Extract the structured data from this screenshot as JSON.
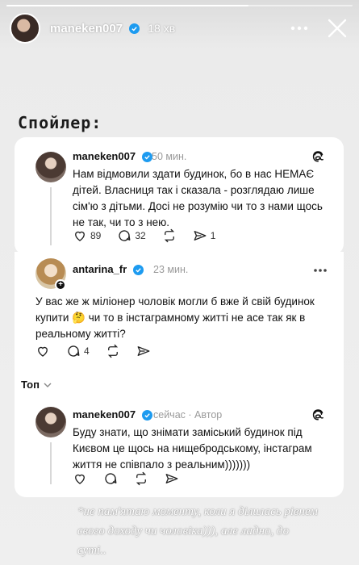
{
  "story": {
    "username": "maneken007",
    "time": "18 хв",
    "progress": 0.7,
    "accent": "#1d9bf0"
  },
  "heading": "Спойлер:",
  "posts": [
    {
      "username": "maneken007",
      "time": "50 мин.",
      "text": "Нам відмовили здати будинок, бо в нас НЕМАЄ дітей. Власниця так і сказала - розглядаю лише сім'ю з дітьми. Досі не розумію чи то з нами щось не так, чи то з нею.",
      "likes": "89",
      "replies": "32",
      "shares": "1"
    },
    {
      "username": "antarina_fr",
      "time": "23 мин.",
      "text": "У вас же ж міліонер чоловік могли б вже й свій будинок купити 🤔 чи то в інстаграмному житті не асе так як в реальному житті?",
      "replies": "4"
    },
    {
      "username": "maneken007",
      "time": "сейчас",
      "author_badge": "Автор",
      "text": "Буду знати, що знімати заміський будинок під Києвом це щось на нищебродському, інстаграм життя не співпало з реальним)))))))"
    }
  ],
  "sort_label": "Топ",
  "caption": "*не пам'ятаю моменту, коли я ділилась рівнем свого доходу чи чоловіка))), але ладно, до суті.."
}
